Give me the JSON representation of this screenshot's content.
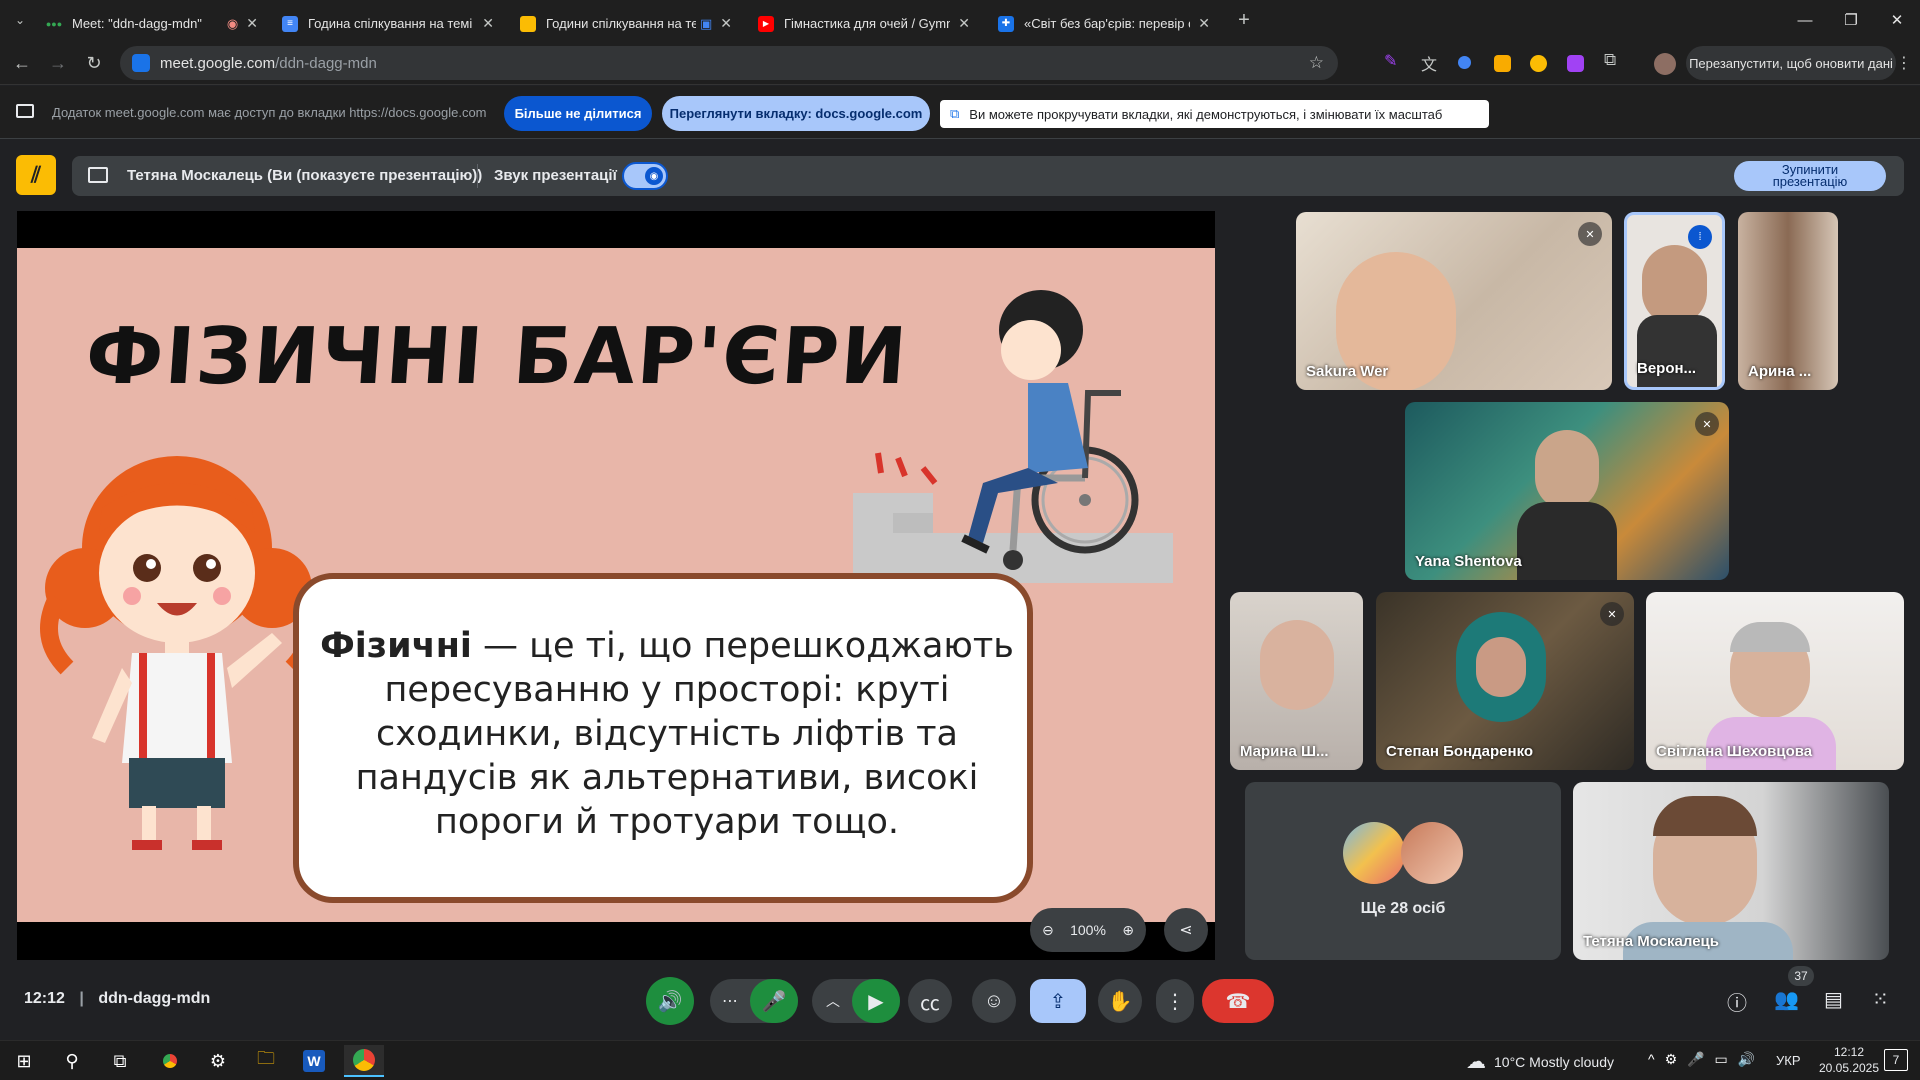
{
  "tabs": [
    {
      "title": "Meet: \"ddn-dagg-mdn\"",
      "icon": "meet-icon",
      "active": true
    },
    {
      "title": "Година спілкування на темі",
      "icon": "docs-icon"
    },
    {
      "title": "Години спілкування на те",
      "icon": "slides-icon"
    },
    {
      "title": "Гімнастика для очей / Gymnas",
      "icon": "youtube-icon"
    },
    {
      "title": "«Світ без бар'єрів: перевір себ",
      "icon": "site-icon"
    }
  ],
  "url": {
    "host": "meet.google.com",
    "path": "/ddn-dagg-mdn"
  },
  "relaunch_label": "Перезапустити, щоб оновити дані",
  "infobar": {
    "message": "Додаток meet.google.com має доступ до вкладки https://docs.google.com",
    "stop_sharing": "Більше не ділитися",
    "view_tab": "Переглянути вкладку: docs.google.com",
    "scroll_hint": "Ви можете прокручувати вкладки, які демонструються, і змінювати їх масштаб"
  },
  "presenting": {
    "label": "Тетяна Москалець (Ви (показуєте презентацію))",
    "audio_label": "Звук презентації",
    "stop_label": "Зупинити презентацію"
  },
  "slide": {
    "title": "ФІЗИЧНІ БАР'ЄРИ",
    "bold_word": "Фізичні",
    "body": " — це ті, що перешкоджають пересуванню у просторі: круті сходинки, відсутність ліфтів та пандусів як альтернативи, високі пороги й тротуари тощо."
  },
  "zoom": {
    "level": "100%"
  },
  "participants": [
    {
      "name": "Sakura Wer",
      "muted": true
    },
    {
      "name": "Верон...",
      "speaking": true
    },
    {
      "name": "Арина ..."
    },
    {
      "name": "Yana Shentova",
      "muted": true
    },
    {
      "name": "Марина Ш..."
    },
    {
      "name": "Степан Бондаренко",
      "muted": true
    },
    {
      "name": "Світлана Шеховцова"
    },
    {
      "name": "Тетяна Москалець"
    }
  ],
  "others": {
    "label": "Ще 28 осіб"
  },
  "meeting": {
    "time": "12:12",
    "code": "ddn-dagg-mdn"
  },
  "people_count": "37",
  "taskbar": {
    "weather": "10°C  Mostly cloudy",
    "lang": "УКР",
    "time": "12:12",
    "date": "20.05.2025",
    "notif": "7"
  },
  "colors": {
    "accent_blue": "#0b57d0",
    "light_blue": "#a8c7fa",
    "meet_green": "#1e8e3e",
    "end_red": "#dc362e",
    "slide_bg": "#e8b6a9"
  }
}
